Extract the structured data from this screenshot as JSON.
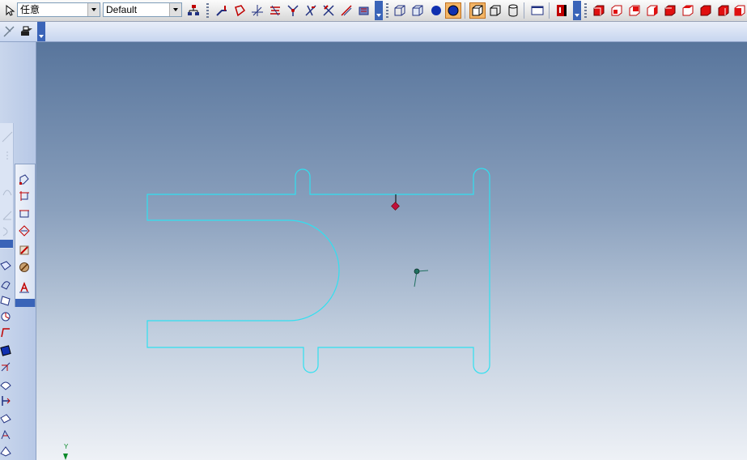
{
  "toolbar": {
    "filter_select": {
      "value": "任意"
    },
    "style_select": {
      "value": "Default"
    }
  },
  "viewport": {
    "axis_label": "Y",
    "colors": {
      "profile": "#30e0f0",
      "marker": "#c0103c",
      "origin": "#207060",
      "background_top": "#58759c",
      "background_bottom": "#eef1f6"
    }
  },
  "icons": {
    "top_toolbar": [
      "select-arrow-icon",
      "tree-icon",
      "sketch-tool-icons",
      "view-cube-icons",
      "render-icons",
      "color-cube-icons"
    ],
    "left_palette": [
      "point-icon",
      "line-icon",
      "rectangle-icon",
      "circle-icon",
      "arc-icon",
      "dimension-icon",
      "text-icon"
    ]
  }
}
